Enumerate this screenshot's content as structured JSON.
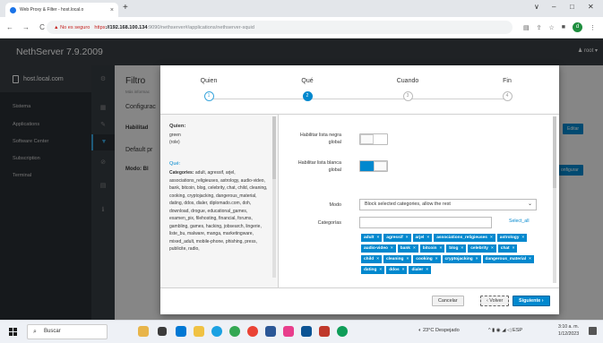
{
  "browser": {
    "tab_title": "Web Proxy & Filter - host.local.o",
    "tab_close": "×",
    "new_tab": "+",
    "warning": "▲ No es seguro",
    "url_scheme": "https",
    "url_host": "://192.168.100.134",
    "url_rest": ":9090/nethserver#/applications/nethserver-squid",
    "profile_letter": "d",
    "win_min": "∨",
    "win_dash": "–",
    "win_max": "□",
    "win_close": "✕"
  },
  "app": {
    "brand": "NethServer 7.9.2009",
    "user": "root"
  },
  "sidebar": {
    "host": "host.local.com",
    "items": [
      {
        "label": "Sistema"
      },
      {
        "label": "Applications"
      },
      {
        "label": "Software Center"
      },
      {
        "label": "Subscription"
      },
      {
        "label": "Terminal"
      }
    ]
  },
  "background": {
    "title": "Filtro",
    "subtitle": "Más informac",
    "section1": "Configurac",
    "card1": "Habilitad",
    "section2": "Default pr",
    "card2": "Modo: Bl",
    "btn_edit": "Editar",
    "btn_configure": "onfigurar"
  },
  "wizard": {
    "steps": [
      {
        "label": "Quien",
        "num": "1"
      },
      {
        "label": "Qué",
        "num": "2"
      },
      {
        "label": "Cuando",
        "num": "3"
      },
      {
        "label": "Fin",
        "num": "4"
      }
    ]
  },
  "summary": {
    "who_heading": "Quien:",
    "who_value": "green",
    "who_role": "(role)",
    "what_link": "Qué:",
    "categories_label": "Categories:",
    "categories_text": "adult, agressif, arjel, associations_religieuses, astrology, audio-video, bank, bitcoin, blog, celebrity, chat, child, cleaning, cooking, cryptojacking, dangerous_material, dating, ddos, dialer, diplomado.com, doh, download, drogue, educational_games, examen_pix, filehosting, financial, forums, gambling, games, hacking, jobsearch, lingerie, liste_bu, malware, manga, marketingware, mixed_adult, mobile-phone, phishing, press, publicite, radio,"
  },
  "form": {
    "blacklist_label": "Habilitar lista negra global",
    "whitelist_label": "Habilitar lista blanca global",
    "mode_label": "Modo",
    "mode_value": "Block selected categories, allow the rest",
    "categories_label": "Categorías",
    "select_all": "Select_all",
    "blacklist_enabled": false,
    "whitelist_enabled": true,
    "tags": [
      "adult",
      "agressif",
      "arjel",
      "associations_religieuses",
      "astrology",
      "audio-video",
      "bank",
      "bitcoin",
      "blog",
      "celebrity",
      "chat",
      "child",
      "cleaning",
      "cooking",
      "cryptojacking",
      "dangerous_material",
      "dating",
      "ddos",
      "dialer"
    ]
  },
  "footer": {
    "cancel": "Cancelar",
    "back": "‹ Volver",
    "next": "Siguiente ›"
  },
  "taskbar": {
    "search": "Buscar",
    "weather": "23°C  Despejado",
    "lang": "ESP",
    "time": "3:10 a. m.",
    "date": "1/12/2023"
  },
  "colors": {
    "accent": "#0088ce",
    "header": "#393f44",
    "sidebar": "#292e34"
  }
}
